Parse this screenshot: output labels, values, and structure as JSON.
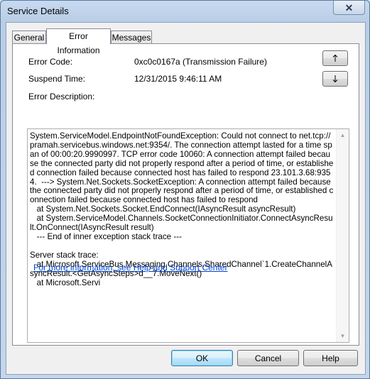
{
  "window": {
    "title": "Service Details",
    "close_glyph": "✕"
  },
  "tabs": [
    {
      "label": "General"
    },
    {
      "label": "Error Information"
    },
    {
      "label": "Messages"
    }
  ],
  "fields": {
    "error_code_label": "Error Code:",
    "error_code_value": "0xc0c0167a (Transmission Failure)",
    "suspend_time_label": "Suspend Time:",
    "suspend_time_value": "12/31/2015 9:46:11 AM",
    "error_description_label": "Error Description:"
  },
  "description": "System.ServiceModel.EndpointNotFoundException: Could not connect to net.tcp://pramah.servicebus.windows.net:9354/. The connection attempt lasted for a time span of 00:00:20.9990997. TCP error code 10060: A connection attempt failed because the connected party did not properly respond after a period of time, or established connection failed because connected host has failed to respond 23.101.3.68:9354.  ---> System.Net.Sockets.SocketException: A connection attempt failed because the connected party did not properly respond after a period of time, or established connection failed because connected host has failed to respond\n   at System.Net.Sockets.Socket.EndConnect(IAsyncResult asyncResult)\n   at System.ServiceModel.Channels.SocketConnectionInitiator.ConnectAsyncResult.OnConnect(IAsyncResult result)\n   --- End of inner exception stack trace ---\n\nServer stack trace:\n   at Microsoft.ServiceBus.Messaging.Channels.SharedChannel`1.CreateChannelAsyncResult.<GetAsyncSteps>d__7.MoveNext()\n   at Microsoft.Servi",
  "help_link": "For more information, see Help and Support Center",
  "buttons": {
    "ok": "OK",
    "cancel": "Cancel",
    "help": "Help"
  },
  "icons": {
    "up": "arrow-up-icon",
    "down": "arrow-down-icon"
  }
}
